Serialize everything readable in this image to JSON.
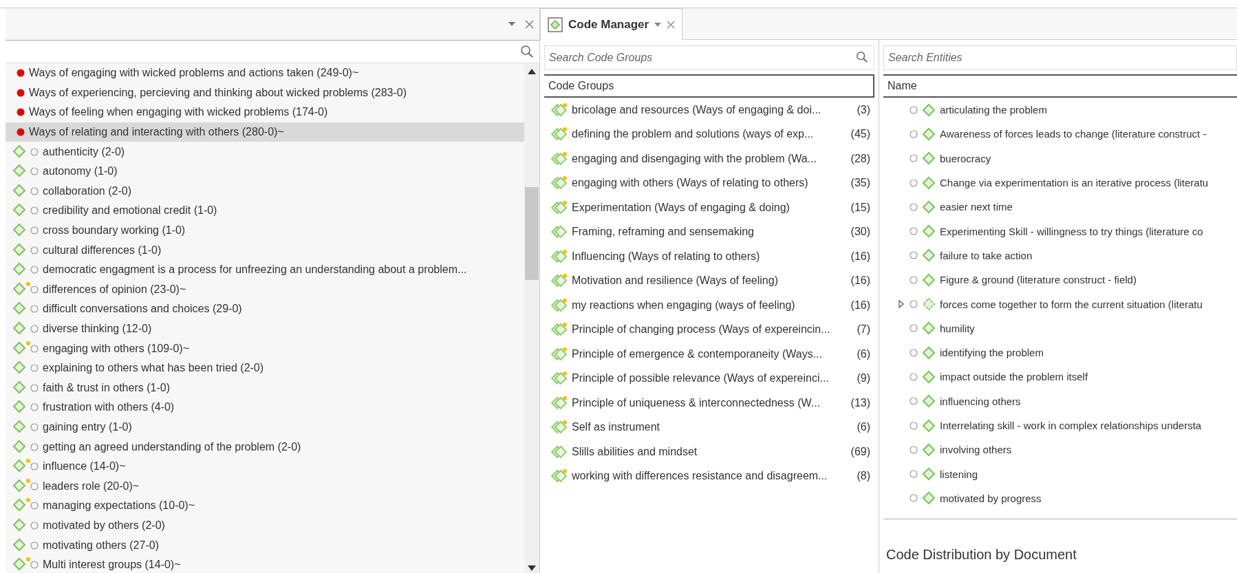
{
  "left_panel": {
    "items": [
      {
        "kind": "category",
        "label": "Ways of engaging with wicked problems and actions taken (249-0)~",
        "selected": false
      },
      {
        "kind": "category",
        "label": "Ways of experiencing, percieving and thinking about wicked problems (283-0)",
        "selected": false
      },
      {
        "kind": "category",
        "label": "Ways of feeling when engaging with wicked problems (174-0)",
        "selected": false
      },
      {
        "kind": "category",
        "label": "Ways of relating and interacting with others (280-0)~",
        "selected": true
      },
      {
        "kind": "code",
        "label": "authenticity (2-0)",
        "memo": false,
        "selected": false
      },
      {
        "kind": "code",
        "label": "autonomy (1-0)",
        "memo": false,
        "selected": false
      },
      {
        "kind": "code",
        "label": "collaboration (2-0)",
        "memo": false,
        "selected": false
      },
      {
        "kind": "code",
        "label": "credibility and emotional credit (1-0)",
        "memo": false,
        "selected": false
      },
      {
        "kind": "code",
        "label": "cross boundary working (1-0)",
        "memo": false,
        "selected": false
      },
      {
        "kind": "code",
        "label": "cultural differences (1-0)",
        "memo": false,
        "selected": false
      },
      {
        "kind": "code",
        "label": "democratic engagment is a process for unfreezing an understanding about a problem...",
        "memo": false,
        "selected": false
      },
      {
        "kind": "code",
        "label": "differences of opinion (23-0)~",
        "memo": true,
        "selected": false
      },
      {
        "kind": "code",
        "label": "difficult conversations and choices (29-0)",
        "memo": false,
        "selected": false
      },
      {
        "kind": "code",
        "label": "diverse thinking (12-0)",
        "memo": false,
        "selected": false
      },
      {
        "kind": "code",
        "label": "engaging with others (109-0)~",
        "memo": true,
        "selected": false
      },
      {
        "kind": "code",
        "label": "explaining to others what has been tried (2-0)",
        "memo": false,
        "selected": false
      },
      {
        "kind": "code",
        "label": "faith & trust in others (1-0)",
        "memo": false,
        "selected": false
      },
      {
        "kind": "code",
        "label": "frustration with others (4-0)",
        "memo": false,
        "selected": false
      },
      {
        "kind": "code",
        "label": "gaining entry (1-0)",
        "memo": false,
        "selected": false
      },
      {
        "kind": "code",
        "label": "getting an agreed understanding of the problem (2-0)",
        "memo": false,
        "selected": false
      },
      {
        "kind": "code",
        "label": "influence (14-0)~",
        "memo": true,
        "selected": false
      },
      {
        "kind": "code",
        "label": "leaders role (20-0)~",
        "memo": true,
        "selected": false
      },
      {
        "kind": "code",
        "label": "managing expectations (10-0)~",
        "memo": true,
        "selected": false
      },
      {
        "kind": "code",
        "label": "motivated by others (2-0)",
        "memo": false,
        "selected": false
      },
      {
        "kind": "code",
        "label": "motivating others (27-0)",
        "memo": false,
        "selected": false
      },
      {
        "kind": "code",
        "label": "Multi interest groups (14-0)~",
        "memo": true,
        "selected": false
      }
    ]
  },
  "code_manager": {
    "tab": {
      "title": "Code Manager",
      "selected": true
    },
    "groups_search": {
      "placeholder": "Search Code Groups"
    },
    "groups_header": "Code Groups",
    "groups": [
      {
        "name": "bricolage and resources (Ways of engaging & doi...",
        "count": "(3)",
        "memo": true
      },
      {
        "name": "defining the problem and solutions (ways of exp...",
        "count": "(45)",
        "memo": true
      },
      {
        "name": "engaging and disengaging with the problem (Wa...",
        "count": "(28)",
        "memo": true
      },
      {
        "name": "engaging with others (Ways of relating to others)",
        "count": "(35)",
        "memo": true
      },
      {
        "name": "Experimentation (Ways of engaging & doing)",
        "count": "(15)",
        "memo": true
      },
      {
        "name": "Framing, reframing and sensemaking",
        "count": "(30)",
        "memo": false
      },
      {
        "name": "Influencing (Ways of relating to others)",
        "count": "(16)",
        "memo": true
      },
      {
        "name": "Motivation and resilience (Ways of feeling)",
        "count": "(16)",
        "memo": true
      },
      {
        "name": "my reactions when engaging (ways of feeling)",
        "count": "(16)",
        "memo": true
      },
      {
        "name": "Principle of changing process (Ways of expereincin...",
        "count": "(7)",
        "memo": true
      },
      {
        "name": "Principle of emergence & contemporaneity (Ways...",
        "count": "(6)",
        "memo": true
      },
      {
        "name": "Principle of possible relevance (Ways of expereinci...",
        "count": "(9)",
        "memo": true
      },
      {
        "name": "Principle of uniqueness & interconnectedness (W...",
        "count": "(13)",
        "memo": true
      },
      {
        "name": "Self as instrument",
        "count": "(6)",
        "memo": true
      },
      {
        "name": "Slills abilities and mindset",
        "count": "(69)",
        "memo": false
      },
      {
        "name": "working with differences resistance and disagreem...",
        "count": "(8)",
        "memo": true
      }
    ],
    "entities_search": {
      "placeholder": "Search Entities"
    },
    "entities_header": "Name",
    "entities": [
      {
        "name": "articulating the problem",
        "has_children": false
      },
      {
        "name": "Awareness of forces leads to change (literature construct -",
        "has_children": false
      },
      {
        "name": "buerocracy",
        "has_children": false
      },
      {
        "name": "Change via experimentation is an iterative process (literatu",
        "has_children": false
      },
      {
        "name": "easier next time",
        "has_children": false
      },
      {
        "name": "Experimenting Skill - willingness to try things (literature co",
        "has_children": false
      },
      {
        "name": "failure to take action",
        "has_children": false
      },
      {
        "name": "Figure & ground (literature construct - field)",
        "has_children": false
      },
      {
        "name": "forces come together to form the current situation (literatu",
        "has_children": true
      },
      {
        "name": "humility",
        "has_children": false
      },
      {
        "name": "identifying the problem",
        "has_children": false
      },
      {
        "name": "impact outside the problem itself",
        "has_children": false
      },
      {
        "name": "influencing others",
        "has_children": false
      },
      {
        "name": "Interrelating skill - work in complex relationships understa",
        "has_children": false
      },
      {
        "name": "involving others",
        "has_children": false
      },
      {
        "name": "listening",
        "has_children": false
      },
      {
        "name": "motivated by progress",
        "has_children": false
      }
    ],
    "distribution_title": "Code Distribution by Document"
  }
}
